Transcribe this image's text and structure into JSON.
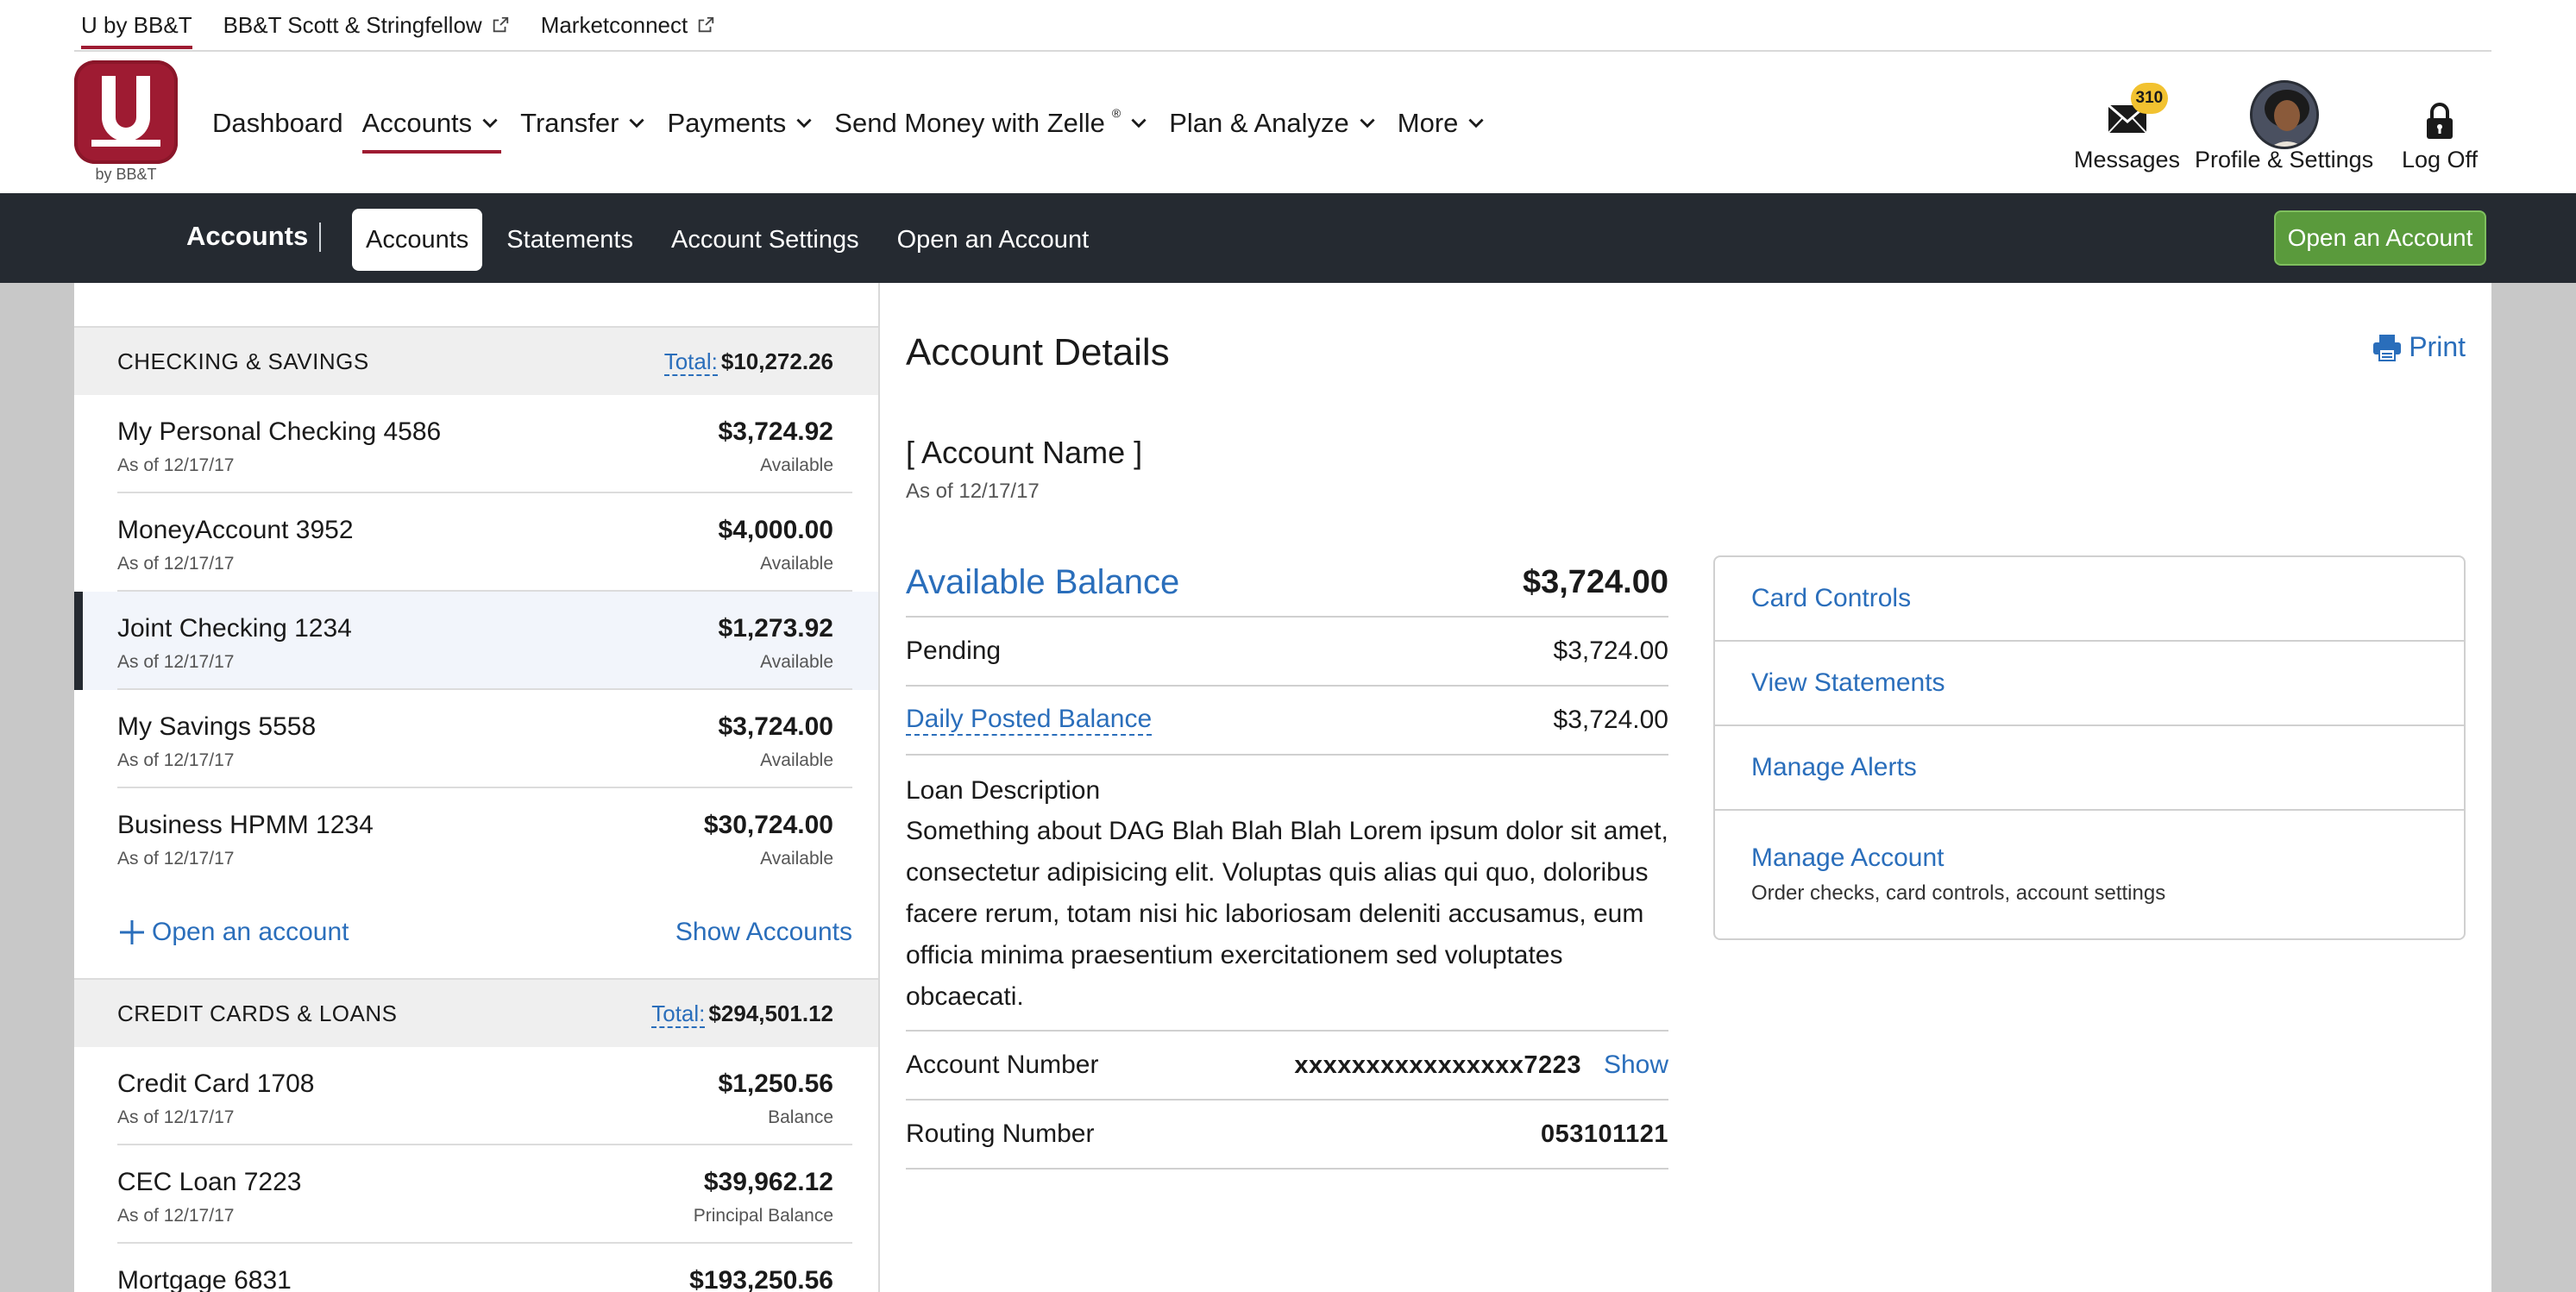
{
  "toplinks": [
    {
      "label": "U by BB&T"
    },
    {
      "label": "BB&T Scott & Stringfellow"
    },
    {
      "label": "Marketconnect"
    }
  ],
  "logo": {
    "letter": "U",
    "sub": "by BB&T"
  },
  "nav": {
    "dashboard": "Dashboard",
    "accounts": "Accounts",
    "transfer": "Transfer",
    "payments": "Payments",
    "zelle": "Send Money with Zelle",
    "zelle_mark": "®",
    "plan": "Plan & Analyze",
    "more": "More"
  },
  "utilities": {
    "messages": "Messages",
    "messages_count": "310",
    "profile": "Profile & Settings",
    "logoff": "Log Off"
  },
  "subnav": {
    "title": "Accounts",
    "tabs": [
      "Accounts",
      "Statements",
      "Account Settings",
      "Open an Account"
    ],
    "open_button": "Open an Account"
  },
  "checking": {
    "label": "CHECKING & SAVINGS",
    "total_label": "Total:",
    "total_value": "$10,272.26",
    "accounts": [
      {
        "name": "My Personal Checking 4586",
        "asof": "As of 12/17/17",
        "amount": "$3,724.92",
        "sub": "Available"
      },
      {
        "name": "MoneyAccount 3952",
        "asof": "As of 12/17/17",
        "amount": "$4,000.00",
        "sub": "Available"
      },
      {
        "name": "Joint Checking 1234",
        "asof": "As of 12/17/17",
        "amount": "$1,273.92",
        "sub": "Available"
      },
      {
        "name": "My Savings 5558",
        "asof": "As of 12/17/17",
        "amount": "$3,724.00",
        "sub": "Available"
      },
      {
        "name": "Business HPMM 1234",
        "asof": "As of 12/17/17",
        "amount": "$30,724.00",
        "sub": "Available"
      }
    ],
    "open_link": "Open an account",
    "show_link": "Show Accounts"
  },
  "credit": {
    "label": "CREDIT CARDS & LOANS",
    "total_label": "Total:",
    "total_value": "$294,501.12",
    "accounts": [
      {
        "name": "Credit Card 1708",
        "asof": "As of 12/17/17",
        "amount": "$1,250.56",
        "sub": "Balance"
      },
      {
        "name": "CEC Loan 7223",
        "asof": "As of 12/17/17",
        "amount": "$39,962.12",
        "sub": "Principal Balance"
      },
      {
        "name": "Mortgage 6831",
        "asof": "",
        "amount": "$193,250.56",
        "sub": ""
      }
    ]
  },
  "details": {
    "title": "Account Details",
    "print": "Print",
    "account_name": "[ Account Name ]",
    "asof": "As of 12/17/17",
    "available_label": "Available Balance",
    "available_value": "$3,724.00",
    "pending_label": "Pending",
    "pending_value": "$3,724.00",
    "daily_label": "Daily Posted Balance",
    "daily_value": "$3,724.00",
    "loan_title": "Loan Description",
    "loan_text": "Something about DAG Blah Blah Blah Lorem ipsum dolor sit amet, consectetur adipisicing elit. Voluptas quis alias qui quo, doloribus facere rerum, totam nisi hic laboriosam deleniti accusamus, eum officia minima praesentium exercitationem sed voluptates obcaecati.",
    "acctnum_label": "Account Number",
    "acctnum_value": "xxxxxxxxxxxxxxxx7223",
    "acctnum_show": "Show",
    "routing_label": "Routing Number",
    "routing_value": "053101121"
  },
  "sidecard": {
    "card_controls": "Card Controls",
    "view_statements": "View Statements",
    "manage_alerts": "Manage Alerts",
    "manage_account": "Manage Account",
    "manage_account_desc": "Order checks, card controls, account settings"
  },
  "colors": {
    "brand": "#9e1b32",
    "link": "#2a6ebb",
    "dark": "#252a31",
    "green": "#5a9a3c",
    "badge": "#f2c230"
  }
}
